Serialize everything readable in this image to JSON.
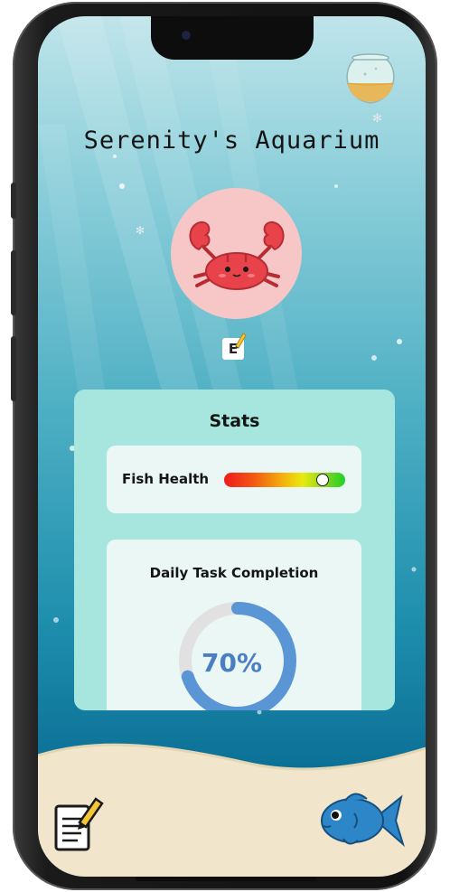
{
  "app": {
    "title": "Serenity's Aquarium"
  },
  "avatar": {
    "creature": "crab"
  },
  "edit_button": {
    "label": "E"
  },
  "stats": {
    "title": "Stats",
    "fish_health": {
      "label": "Fish Health",
      "level": 0.85
    },
    "daily_tasks": {
      "label": "Daily Task Completion",
      "percent_text": "70%",
      "percent": 70
    }
  },
  "icons": {
    "fishbowl": "fishbowl-icon",
    "notes": "notes-icon",
    "fish": "fish-icon"
  },
  "colors": {
    "card": "#a6e6de",
    "ring_fill": "#5a95d6",
    "ring_track": "#e1e1e1",
    "avatar_bg": "#f6c7c6"
  }
}
